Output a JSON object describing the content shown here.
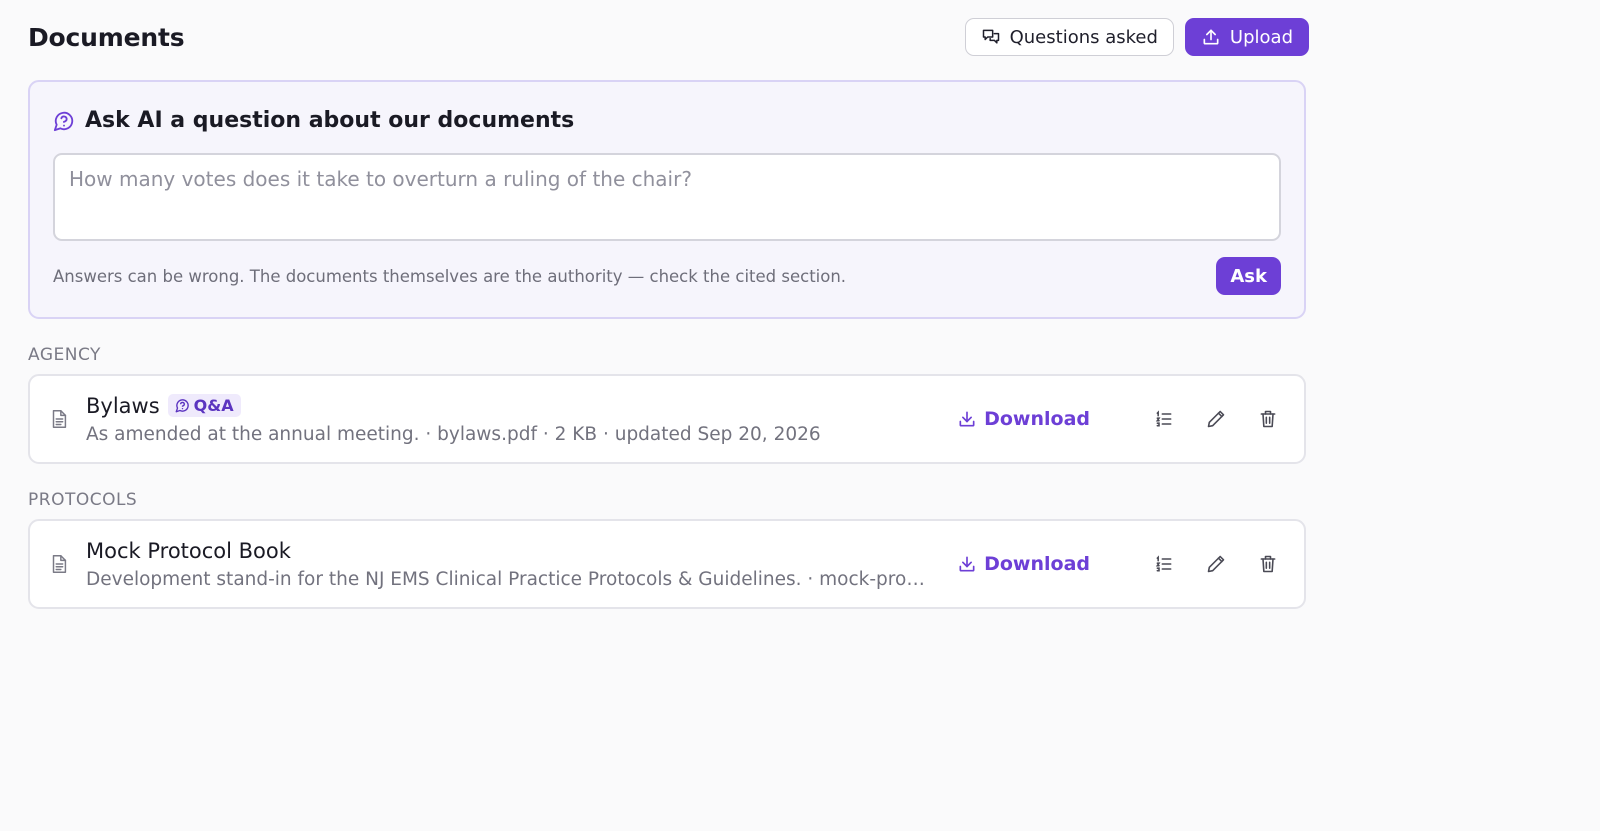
{
  "page": {
    "title": "Documents"
  },
  "header": {
    "questions_label": "Questions asked",
    "upload_label": "Upload"
  },
  "ask": {
    "title": "Ask AI a question about our documents",
    "placeholder": "How many votes does it take to overturn a ruling of the chair?",
    "disclaimer": "Answers can be wrong. The documents themselves are the authority — check the cited section.",
    "button_label": "Ask"
  },
  "sections": [
    {
      "label": "AGENCY",
      "doc": {
        "title": "Bylaws",
        "badge": "Q&A",
        "meta": "As amended at the annual meeting. · bylaws.pdf · 2 KB · updated Sep 20, 2026",
        "download_label": "Download"
      }
    },
    {
      "label": "PROTOCOLS",
      "doc": {
        "title": "Mock Protocol Book",
        "meta": "Development stand-in for the NJ EMS Clinical Practice Protocols & Guidelines. · mock-proto...",
        "download_label": "Download"
      }
    }
  ],
  "icons": {
    "questions": "chat-bubbles-icon",
    "upload": "upload-icon",
    "ask": "message-circle-question-icon",
    "document": "document-icon",
    "download": "download-icon",
    "list": "list-icon",
    "edit": "pencil-icon",
    "delete": "trash-icon"
  },
  "colors": {
    "accent": "#6d3fd6",
    "background": "#fafafb",
    "ask_card_bg": "#f6f5fc"
  }
}
